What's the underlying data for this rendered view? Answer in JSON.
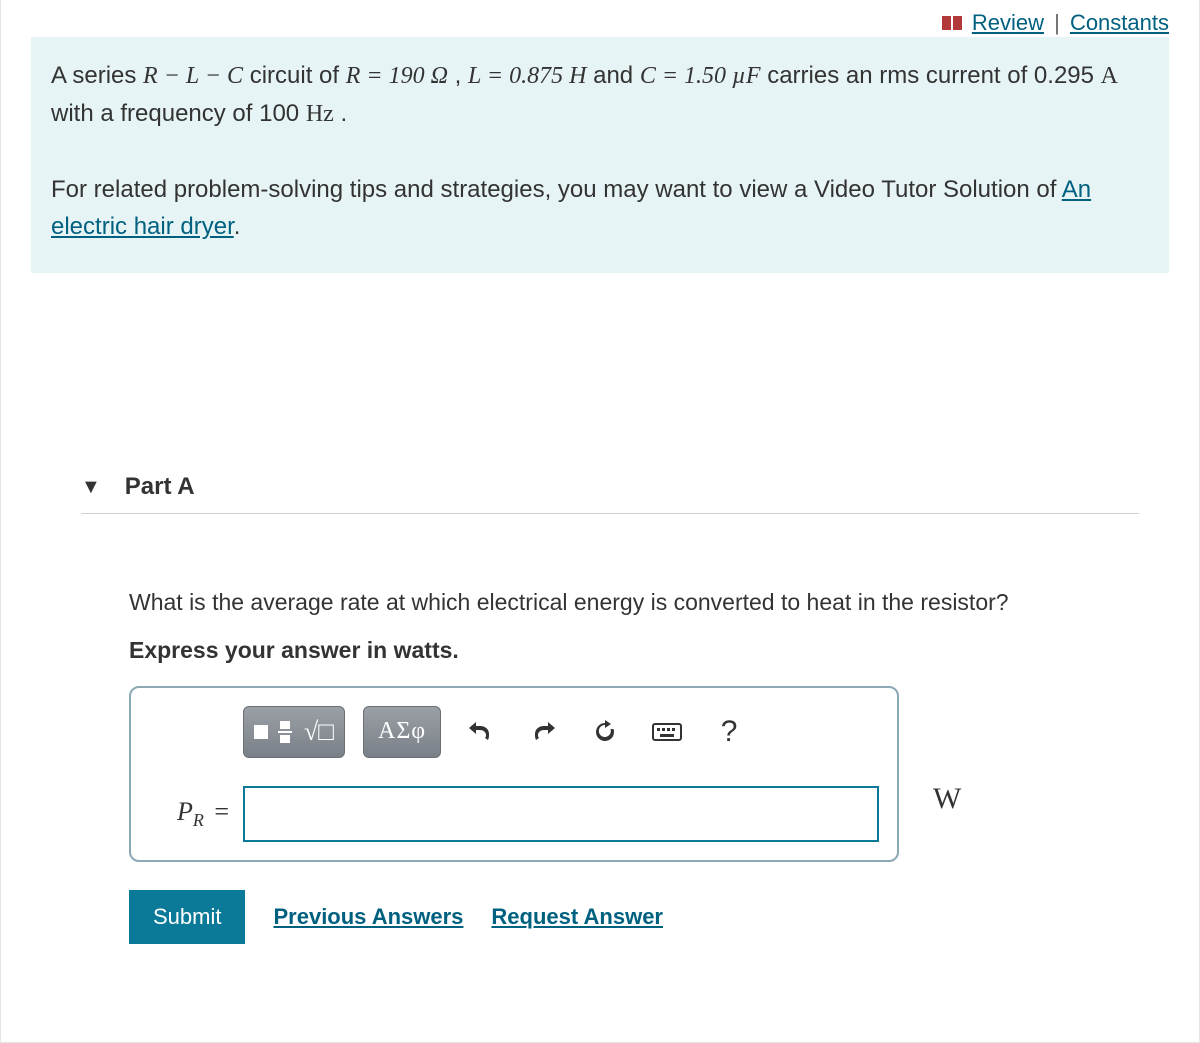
{
  "header": {
    "review_label": "Review",
    "constants_label": "Constants"
  },
  "problem": {
    "text_before_R": "A series ",
    "rlc": "R − L − C",
    "text_after_rlc": " circuit of  ",
    "R_expr": "R = 190 Ω",
    "comma_sep": " ,  ",
    "L_expr": "L = 0.875 H",
    "and_text": " and ",
    "C_expr": "C = 1.50 µF",
    "text_after_C": " carries an rms current of 0.295 ",
    "A_unit": "A",
    "text_freq": " with a frequency of 100 ",
    "Hz_unit": "Hz",
    "period": " .",
    "tips_text": "For related problem-solving tips and strategies, you may want to view a Video Tutor Solution of ",
    "tips_link": "An electric hair dryer",
    "tips_period": "."
  },
  "partA": {
    "title": "Part A",
    "question": "What is the average rate at which electrical energy is converted to heat in the resistor?",
    "instruction": "Express your answer in watts.",
    "symbols_btn": "ΑΣφ",
    "help_btn": "?",
    "var_label_P": "P",
    "var_label_R": "R",
    "equals": " =",
    "answer_value": "",
    "unit": "W"
  },
  "actions": {
    "submit": "Submit",
    "previous": "Previous Answers",
    "request": "Request Answer"
  }
}
